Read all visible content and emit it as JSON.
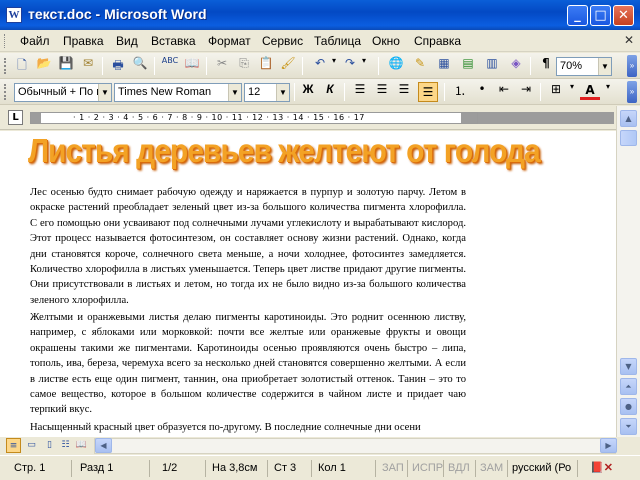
{
  "window": {
    "title": "текст.doc - Microsoft Word",
    "icon": "word-doc-icon",
    "controls": [
      "minimize",
      "maximize",
      "close"
    ]
  },
  "menu": {
    "items": [
      "Файл",
      "Правка",
      "Вид",
      "Вставка",
      "Формат",
      "Сервис",
      "Таблица",
      "Окно",
      "Справка"
    ]
  },
  "toolbar_standard": {
    "zoom": "70%",
    "icons": [
      "new-icon",
      "open-icon",
      "save-icon",
      "permission-icon",
      "print-icon",
      "print-preview-icon",
      "spelling-icon",
      "research-icon",
      "cut-icon",
      "copy-icon",
      "paste-icon",
      "format-painter-icon",
      "undo-icon",
      "redo-icon",
      "hyperlink-icon",
      "tables-borders-icon",
      "insert-table-icon",
      "insert-excel-icon",
      "columns-icon",
      "drawing-icon",
      "document-map-icon",
      "show-formatting-icon"
    ]
  },
  "toolbar_formatting": {
    "style": "Обычный + По ц",
    "font": "Times New Roman",
    "size": "12",
    "bold_label": "Ж",
    "italic_label": "К"
  },
  "document": {
    "heading": "Листья деревьев желтеют от голода",
    "paragraphs": [
      "Лес осенью будто снимает рабочую одежду и наряжается в пурпур и золотую парчу. Летом в окраске растений преобладает зеленый цвет из-за большого количества пигмента хлорофилла. С его помощью они усваивают под солнечными лучами углекислоту и вырабатывают кислород. Этот процесс называется фотосинтезом, он составляет основу жизни растений. Однако, когда дни становятся короче, солнечного света меньше, а ночи холоднее, фотосинтез замедляется. Количество хлорофилла в листьях уменьшается. Теперь цвет листве придают другие пигменты. Они присутствовали в листьях и летом, но тогда их не было видно из-за большого количества зеленого хлорофилла.",
      "Желтыми и оранжевыми листья делаю пигменты каротиноиды. Это роднит осеннюю листву, например, с яблоками или морковкой: почти все желтые или оранжевые фрукты и овощи окрашены такими же пигментами. Каротиноиды осенью проявляются очень быстро – липа, тополь, ива, береза, черемуха всего за несколько дней становятся совершенно желтыми. А если в листве есть еще один пигмент, таннин, она приобретает золотистый оттенок. Танин – это то самое вещество, которое в большом количестве содержится в чайном листе и придает чаю терпкий вкус.",
      "Насыщенный красный цвет образуется по-другому. В последние солнечные дни осени"
    ]
  },
  "statusbar": {
    "page": "Стр. 1",
    "section": "Разд 1",
    "pages": "1/2",
    "position": "На 3,8см",
    "line": "Ст 3",
    "column": "Кол 1",
    "rec": "ЗАП",
    "trk": "ИСПР",
    "ext": "ВДЛ",
    "ovr": "ЗАМ",
    "language": "русский (Ро"
  }
}
